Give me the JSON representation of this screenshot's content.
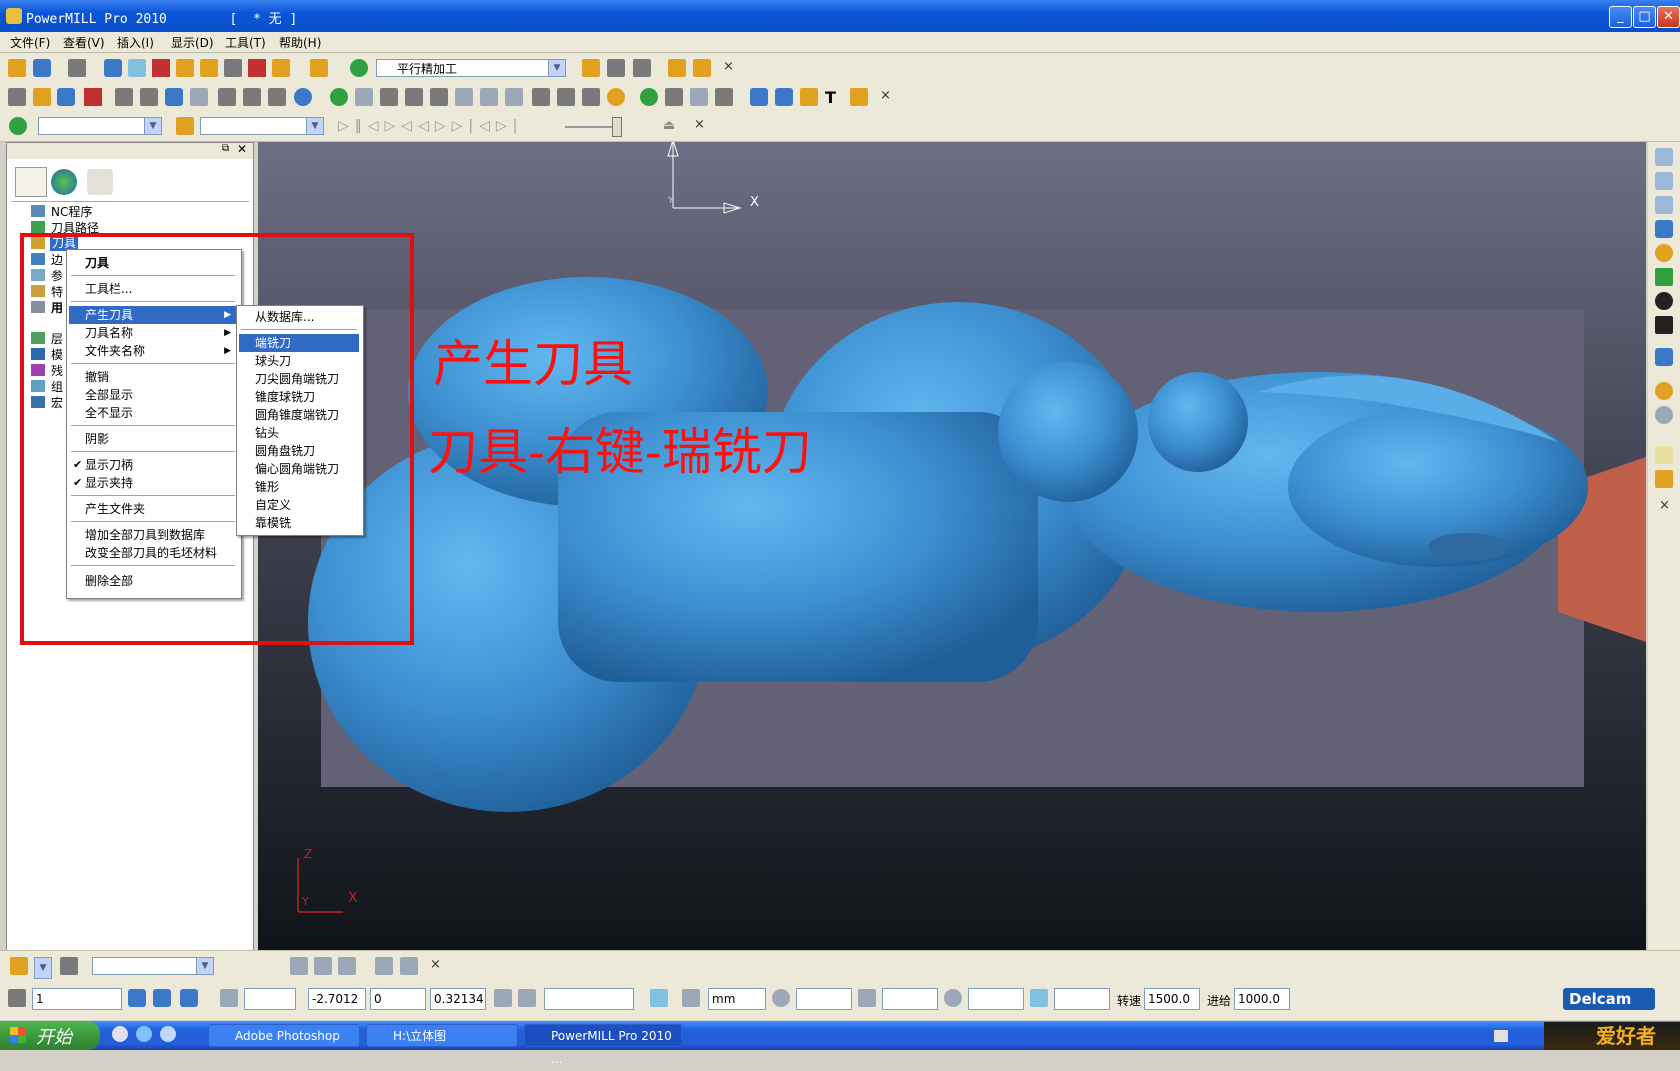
{
  "window": {
    "title": "PowerMILL Pro 2010        [  * 无 ]",
    "buttons": {
      "minimize": "_",
      "maximize": "□",
      "close": "✕"
    }
  },
  "menubar": [
    "文件(F)",
    "查看(V)",
    "插入(I)",
    "显示(D)",
    "工具(T)",
    "帮助(H)"
  ],
  "toolbar1": {
    "strategy_combo": "平行精加工"
  },
  "toolbar_close": "×",
  "tree": {
    "items": [
      {
        "label": "NC程序",
        "icon": "nc-program-icon"
      },
      {
        "label": "刀具路径",
        "icon": "toolpath-icon"
      },
      {
        "label": "刀具",
        "icon": "tool-icon",
        "selected": true
      },
      {
        "label": "边",
        "icon": "boundary-icon"
      },
      {
        "label": "参",
        "icon": "reference-icon"
      },
      {
        "label": "特",
        "icon": "feature-icon"
      },
      {
        "label": "用",
        "icon": "user-icon"
      },
      {
        "label": "层",
        "icon": "layer-icon"
      },
      {
        "label": "模",
        "icon": "model-icon"
      },
      {
        "label": "残",
        "icon": "stock-icon"
      },
      {
        "label": "组",
        "icon": "group-icon"
      },
      {
        "label": "宏",
        "icon": "macro-icon"
      }
    ]
  },
  "context_menu": {
    "items": [
      {
        "label": "刀具",
        "bold": true
      },
      {
        "sep": true
      },
      {
        "label": "工具栏..."
      },
      {
        "sep": true
      },
      {
        "label": "产生刀具",
        "submenu": true,
        "highlighted": true
      },
      {
        "label": "刀具名称",
        "submenu": true
      },
      {
        "label": "文件夹名称",
        "submenu": true
      },
      {
        "sep": true
      },
      {
        "label": "撤销"
      },
      {
        "label": "全部显示"
      },
      {
        "label": "全不显示"
      },
      {
        "sep": true
      },
      {
        "label": "阴影"
      },
      {
        "sep": true
      },
      {
        "label": "显示刀柄",
        "checked": true
      },
      {
        "label": "显示夹持",
        "checked": true
      },
      {
        "sep": true
      },
      {
        "label": "产生文件夹"
      },
      {
        "sep": true
      },
      {
        "label": "增加全部刀具到数据库"
      },
      {
        "label": "改变全部刀具的毛坯材料"
      },
      {
        "sep": true
      },
      {
        "label": "删除全部"
      }
    ]
  },
  "submenu": {
    "items": [
      {
        "label": "从数据库..."
      },
      {
        "sep": true
      },
      {
        "label": "端铣刀",
        "highlighted": true
      },
      {
        "label": "球头刀"
      },
      {
        "label": "刀尖圆角端铣刀"
      },
      {
        "label": "锥度球铣刀"
      },
      {
        "label": "圆角锥度端铣刀"
      },
      {
        "label": "钻头"
      },
      {
        "label": "圆角盘铣刀"
      },
      {
        "label": "偏心圆角端铣刀"
      },
      {
        "label": "锥形"
      },
      {
        "label": "自定义"
      },
      {
        "label": "靠模铣"
      }
    ]
  },
  "annotations": {
    "line1": "产生刀具",
    "line2": "刀具-右键-瑞铣刀"
  },
  "viewport_axes": {
    "top_x": "X",
    "top_y": "Y",
    "corner_z": "Z",
    "corner_y": "Y",
    "corner_x": "X"
  },
  "status": {
    "workplane": "1",
    "coord_x": "-2.7012",
    "coord_y": "0",
    "coord_z": "0.32134",
    "units": "mm",
    "spindle_label": "转速",
    "spindle_value": "1500.0",
    "feed_label": "进给",
    "feed_value": "1000.0",
    "brand": "Delcam"
  },
  "taskbar": {
    "start": "开始",
    "tasks": [
      "Adobe Photoshop",
      "H:\\立体图",
      "PowerMILL Pro 2010 ..."
    ],
    "tray_logo": "爱好者"
  },
  "colors": {
    "accent": "#316ac5",
    "model": "#3d8fd0",
    "annotation": "#ff1010"
  }
}
